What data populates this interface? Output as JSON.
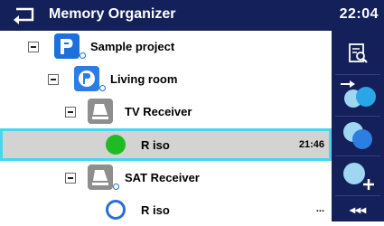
{
  "header": {
    "title": "Memory Organizer",
    "time": "22:04"
  },
  "tree": {
    "project": "Sample project",
    "room": "Living room",
    "device1": "TV Receiver",
    "measurement1": {
      "label": "R iso",
      "time": "21:46",
      "status": "pass"
    },
    "device2": "SAT Receiver",
    "measurement2": {
      "label": "R iso",
      "time": "...",
      "status": "empty"
    }
  },
  "colors": {
    "header": "#13205a",
    "pass": "#1fbb22",
    "selection": "#46d7ef",
    "accent": "#1d6fdb"
  },
  "sidebar": {
    "icons": [
      "view-results-icon",
      "copy-node-icon",
      "clone-icon",
      "add-measurement-icon",
      "more-options-icon"
    ],
    "more": "◂◂◂"
  }
}
